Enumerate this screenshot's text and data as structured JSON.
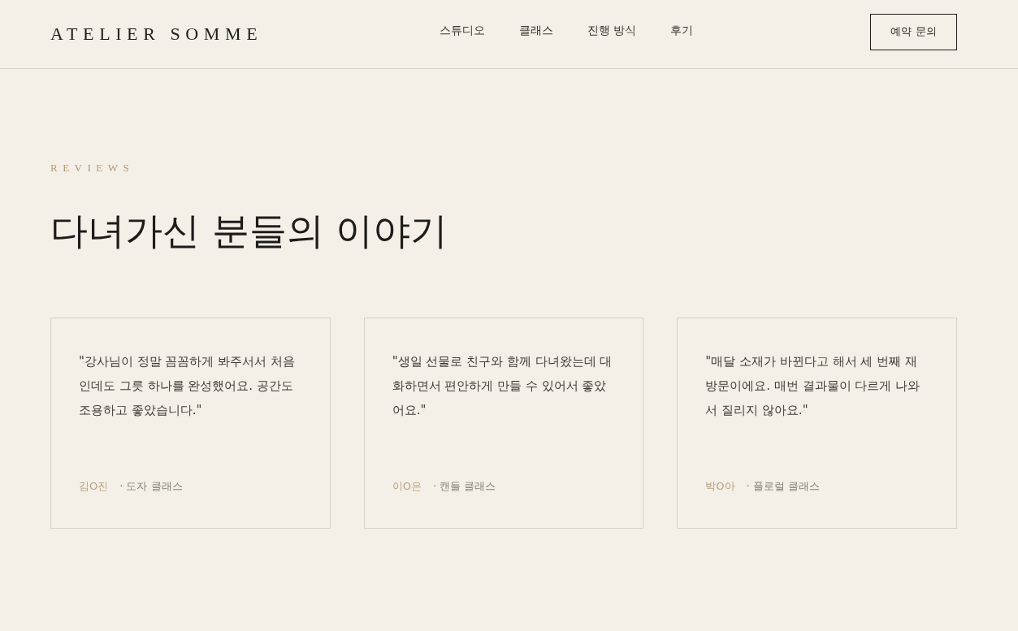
{
  "header": {
    "logo": "ATELIER SOMME",
    "nav": [
      "스튜디오",
      "클래스",
      "진행 방식",
      "후기"
    ],
    "cta": "예약 문의"
  },
  "section": {
    "eyebrow": "REVIEWS",
    "title": "다녀가신 분들의 이야기"
  },
  "reviews": [
    {
      "quote": "\"강사님이 정말 꼼꼼하게 봐주서서 처음인데도 그릇 하나를 완성했어요. 공간도 조용하고 좋았습니다.\"",
      "author": "김O진",
      "class": "· 도자 클래스"
    },
    {
      "quote": "\"생일 선물로 친구와 함께 다녀왔는데 대화하면서 편안하게 만들 수 있어서 좋았어요.\"",
      "author": "이O은",
      "class": "· 캔들 클래스"
    },
    {
      "quote": "\"매달 소재가 바뀐다고 해서 세 번째 재방문이에요. 매번 결과물이 다르게 나와서 질리지 않아요.\"",
      "author": "박O아",
      "class": "· 플로럴 클래스"
    }
  ]
}
